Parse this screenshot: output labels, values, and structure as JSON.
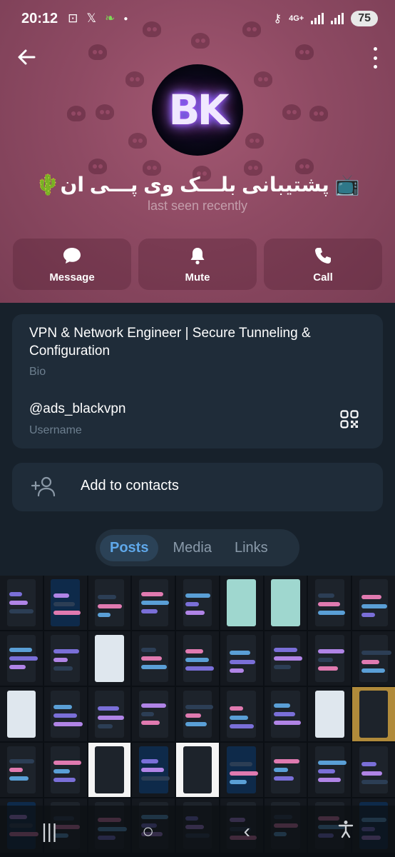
{
  "status_bar": {
    "time": "20:12",
    "network": "4G+",
    "battery": "75"
  },
  "profile": {
    "avatar_text": "BK",
    "name": "📺 پشتیبانی بلـــک وی پـــی ان🌵",
    "status": "last seen recently"
  },
  "actions": [
    {
      "label": "Message",
      "icon": "message-icon"
    },
    {
      "label": "Mute",
      "icon": "bell-icon"
    },
    {
      "label": "Call",
      "icon": "phone-icon"
    }
  ],
  "info": {
    "bio": "VPN & Network Engineer | Secure Tunneling & Configuration",
    "bio_label": "Bio",
    "username": "@ads_blackvpn",
    "username_label": "Username"
  },
  "add_contact": {
    "label": "Add to contacts"
  },
  "tabs": [
    {
      "label": "Posts",
      "active": true
    },
    {
      "label": "Media",
      "active": false
    },
    {
      "label": "Links",
      "active": false
    }
  ],
  "nav": {
    "recent": "|||",
    "home": "○",
    "back": "‹"
  },
  "colors": {
    "header": "#8e4a63",
    "background": "#17212b",
    "card": "#1f2c39",
    "accent": "#5fa8ea"
  }
}
